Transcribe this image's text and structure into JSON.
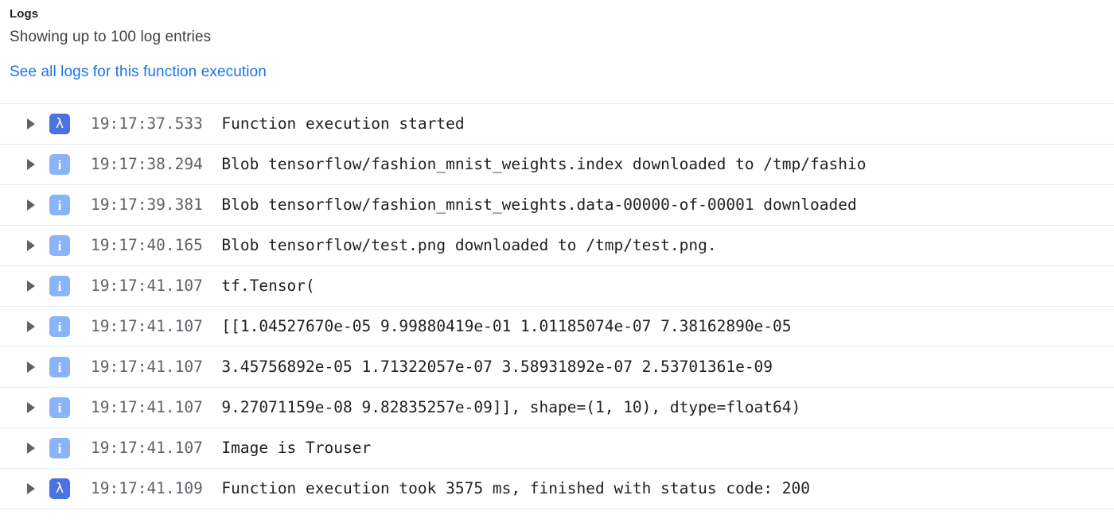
{
  "header": {
    "title": "Logs",
    "subtitle": "Showing up to 100 log entries",
    "link_label": "See all logs for this function execution",
    "link_color": "#1a73e8"
  },
  "colors": {
    "debug_icon_bg": "#4a72e0",
    "info_icon_bg": "#8ab4f8",
    "row_divider": "#e8eaed",
    "timestamp_text": "#5f6368",
    "message_text": "#202124"
  },
  "log_table": {
    "rows": [
      {
        "icon": "lambda-icon",
        "icon_glyph": "λ",
        "severity": "debug",
        "timestamp": "19:17:37.533",
        "message": "Function execution started"
      },
      {
        "icon": "info-icon",
        "icon_glyph": "i",
        "severity": "info",
        "timestamp": "19:17:38.294",
        "message": "Blob tensorflow/fashion_mnist_weights.index downloaded to /tmp/fashio"
      },
      {
        "icon": "info-icon",
        "icon_glyph": "i",
        "severity": "info",
        "timestamp": "19:17:39.381",
        "message": "Blob tensorflow/fashion_mnist_weights.data-00000-of-00001 downloaded"
      },
      {
        "icon": "info-icon",
        "icon_glyph": "i",
        "severity": "info",
        "timestamp": "19:17:40.165",
        "message": "Blob tensorflow/test.png downloaded to /tmp/test.png."
      },
      {
        "icon": "info-icon",
        "icon_glyph": "i",
        "severity": "info",
        "timestamp": "19:17:41.107",
        "message": "tf.Tensor("
      },
      {
        "icon": "info-icon",
        "icon_glyph": "i",
        "severity": "info",
        "timestamp": "19:17:41.107",
        "message": "[[1.04527670e-05 9.99880419e-01 1.01185074e-07 7.38162890e-05"
      },
      {
        "icon": "info-icon",
        "icon_glyph": "i",
        "severity": "info",
        "timestamp": "19:17:41.107",
        "message": "3.45756892e-05 1.71322057e-07 3.58931892e-07 2.53701361e-09"
      },
      {
        "icon": "info-icon",
        "icon_glyph": "i",
        "severity": "info",
        "timestamp": "19:17:41.107",
        "message": "9.27071159e-08 9.82835257e-09]], shape=(1, 10), dtype=float64)"
      },
      {
        "icon": "info-icon",
        "icon_glyph": "i",
        "severity": "info",
        "timestamp": "19:17:41.107",
        "message": "Image is Trouser"
      },
      {
        "icon": "lambda-icon",
        "icon_glyph": "λ",
        "severity": "debug",
        "timestamp": "19:17:41.109",
        "message": "Function execution took 3575 ms, finished with status code: 200"
      }
    ]
  }
}
